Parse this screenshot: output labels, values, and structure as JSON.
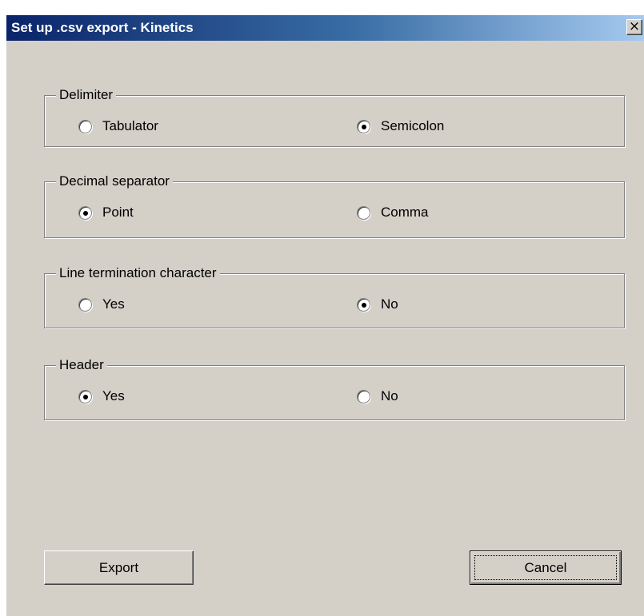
{
  "window": {
    "title": "Set up .csv export - Kinetics",
    "close_symbol": "×"
  },
  "groups": [
    {
      "legend": "Delimiter",
      "options": [
        {
          "label": "Tabulator",
          "checked": false
        },
        {
          "label": "Semicolon",
          "checked": true
        }
      ]
    },
    {
      "legend": "Decimal separator",
      "options": [
        {
          "label": "Point",
          "checked": true
        },
        {
          "label": "Comma",
          "checked": false
        }
      ]
    },
    {
      "legend": "Line termination character",
      "options": [
        {
          "label": "Yes",
          "checked": false
        },
        {
          "label": "No",
          "checked": true
        }
      ]
    },
    {
      "legend": "Header",
      "options": [
        {
          "label": "Yes",
          "checked": true
        },
        {
          "label": "No",
          "checked": false
        }
      ]
    }
  ],
  "buttons": {
    "export_label": "Export",
    "cancel_label": "Cancel"
  },
  "colors": {
    "dialog_bg": "#d4d0c8",
    "title_gradient_start": "#0a246a",
    "title_gradient_end": "#a6caf0"
  },
  "icons": {
    "close": "close-icon"
  }
}
